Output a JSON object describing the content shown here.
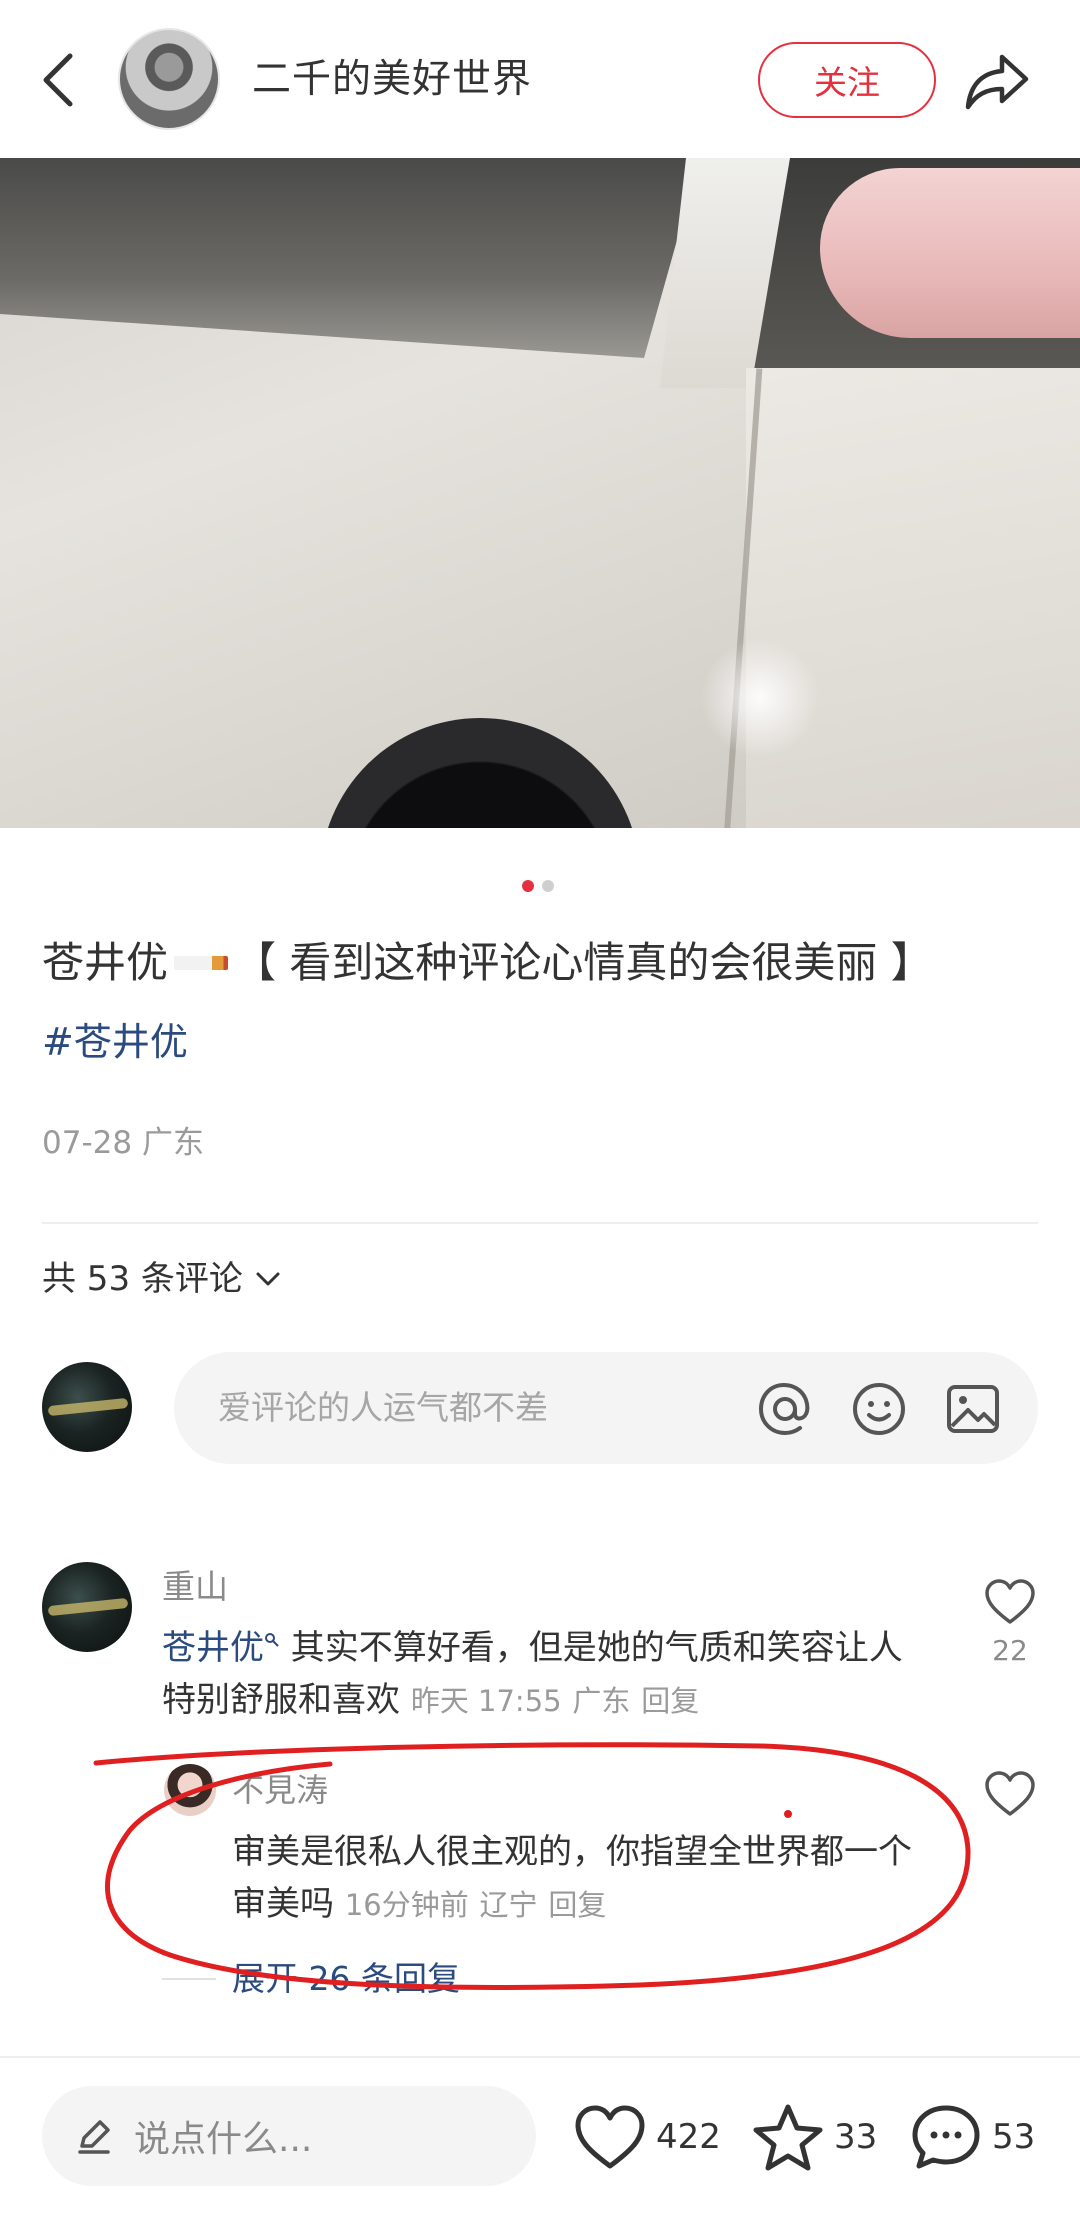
{
  "header": {
    "author_name": "二千的美好世界",
    "follow_label": "关注"
  },
  "carousel": {
    "current": 1,
    "total": 2
  },
  "post": {
    "title_prefix": "苍井优",
    "title_main": "【 看到这种评论心情真的会很美丽 】",
    "hashtag": "#苍井优",
    "date": "07-28",
    "location": "广东"
  },
  "comments_header": {
    "label": "共 53 条评论"
  },
  "comment_input": {
    "placeholder": "爱评论的人运气都不差"
  },
  "comments": [
    {
      "user": "重山",
      "mention": "苍井优",
      "text": " 其实不算好看，但是她的气质和笑容让人特别舒服和喜欢",
      "time": "昨天 17:55",
      "location": "广东",
      "reply_label": "回复",
      "likes": "22",
      "replies": [
        {
          "user": "不見涛",
          "text": "审美是很私人很主观的，你指望全世界都一个审美吗",
          "time": "16分钟前",
          "location": "辽宁",
          "reply_label": "回复"
        }
      ],
      "expand_label": "展开 26 条回复"
    }
  ],
  "bottom_bar": {
    "input_placeholder": "说点什么...",
    "likes": "422",
    "favorites": "33",
    "comments": "53"
  },
  "colors": {
    "accent": "#e4303f",
    "link": "#2b4a7d",
    "annotation": "#e02020"
  }
}
